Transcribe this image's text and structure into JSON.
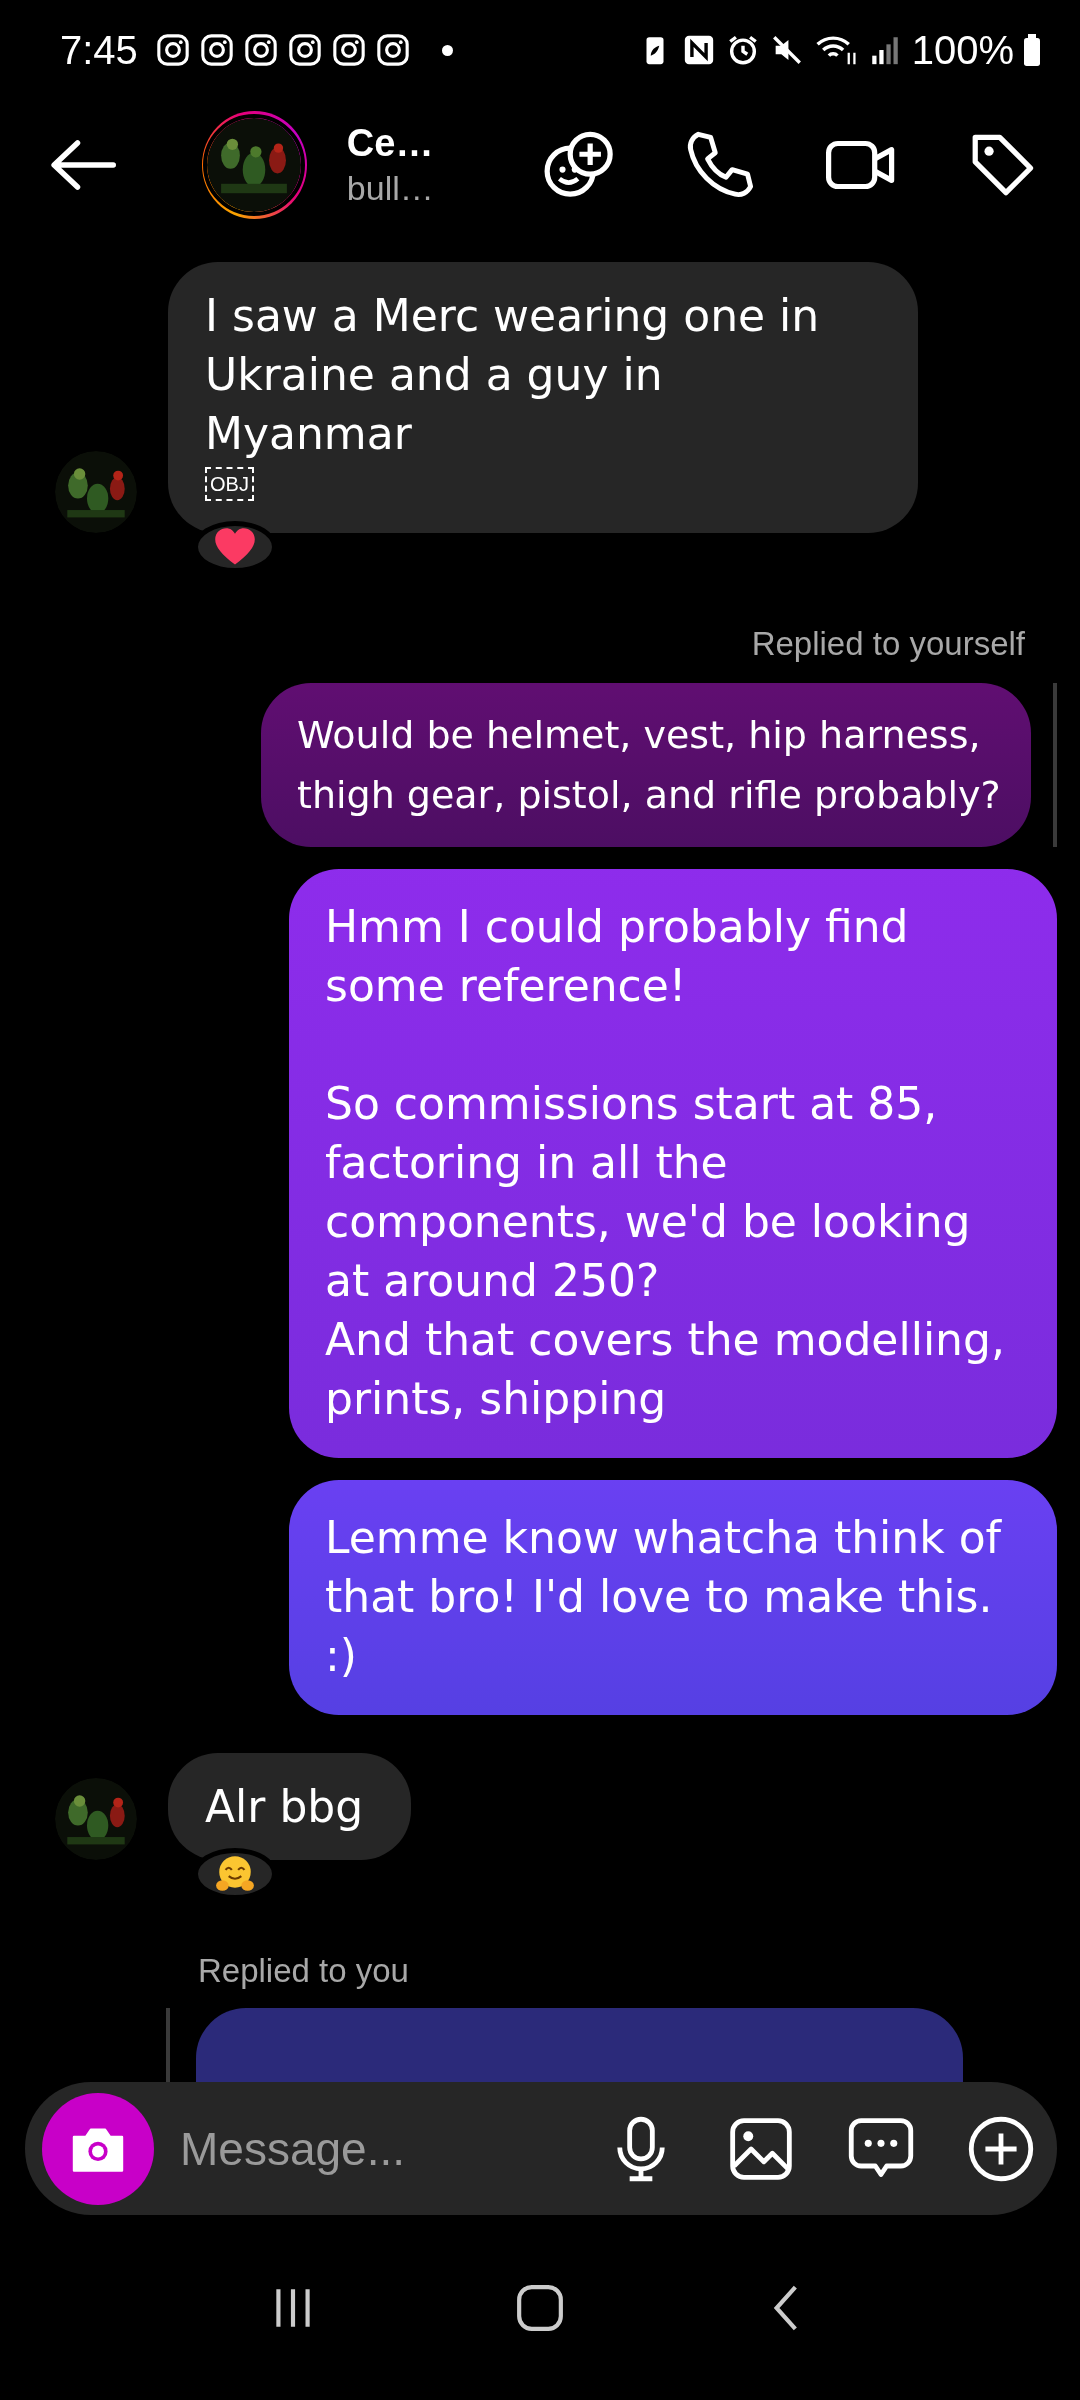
{
  "status_bar": {
    "time": "7:45",
    "notifications": [
      {
        "kind": "app"
      },
      {
        "kind": "app"
      },
      {
        "kind": "app"
      },
      {
        "kind": "app"
      },
      {
        "kind": "app"
      },
      {
        "kind": "app"
      },
      {
        "kind": "dot"
      }
    ],
    "battery": "100%"
  },
  "header": {
    "name": "Ce…",
    "subtitle": "bull…"
  },
  "messages": [
    {
      "kind": "received",
      "text": "I saw a Merc wearing one in Ukraine and a guy in Myanmar",
      "attachment": "OBJ",
      "reaction": {
        "kind": "heart"
      }
    },
    {
      "kind": "sent",
      "color": "#530f68",
      "reply_label": "Replied to yourself",
      "text": "Would be helmet, vest, hip harness, thigh gear, pistol, and rifle probably?"
    },
    {
      "kind": "sent",
      "color": "#8430ec",
      "text": "Hmm I could probably find some reference!\n\nSo commissions start at 85, factoring in all the components, we'd be looking at around 250?\nAnd that covers the modelling, prints, shipping"
    },
    {
      "kind": "sent",
      "color": "#5d45f3",
      "text": "Lemme know whatcha think of that bro! I'd love to make this. :)"
    },
    {
      "kind": "received",
      "text": "Alr bbg",
      "reaction": {
        "kind": "hug"
      }
    },
    {
      "kind": "received_partial",
      "reply_label": "Replied to you"
    }
  ],
  "composer": {
    "placeholder": "Message..."
  }
}
